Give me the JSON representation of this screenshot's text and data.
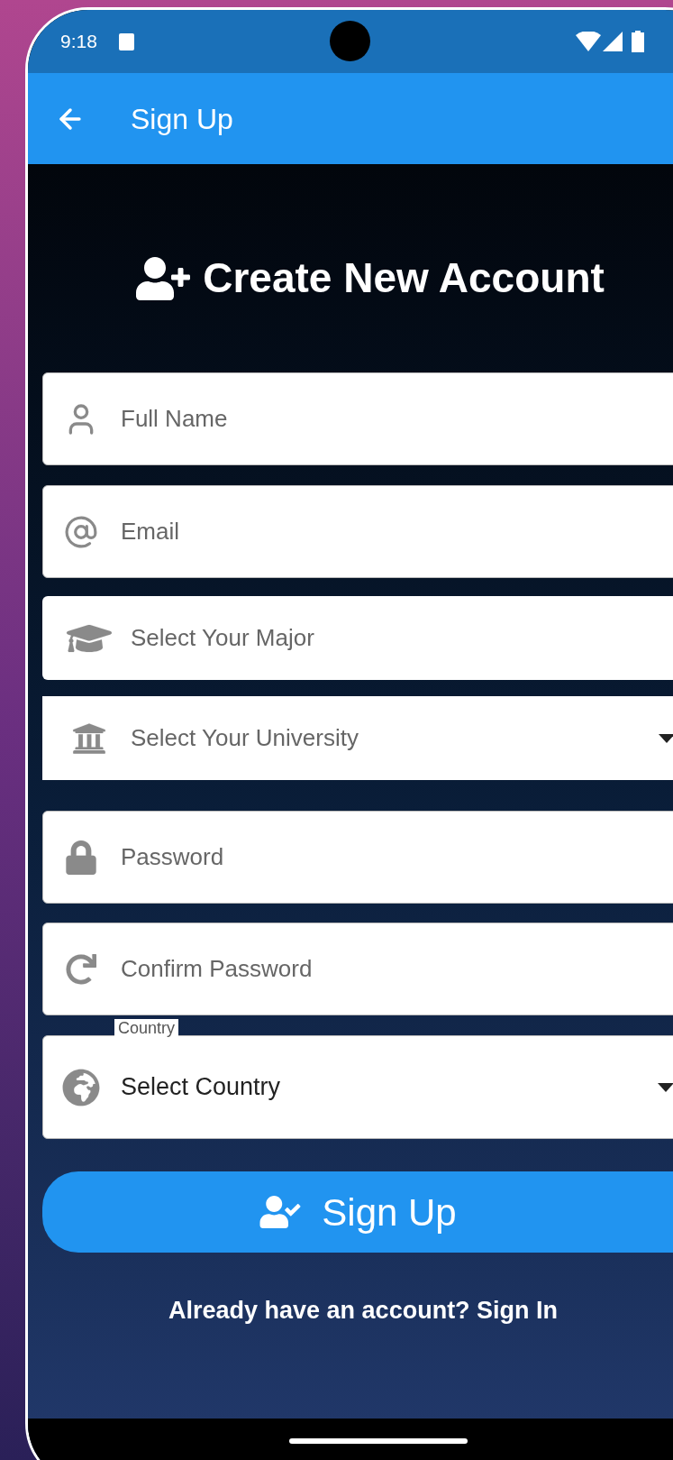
{
  "status_bar": {
    "time": "9:18"
  },
  "app_bar": {
    "title": "Sign Up"
  },
  "heading": "Create New Account",
  "fields": [
    {
      "kind": "input",
      "placeholder": "Full Name"
    },
    {
      "kind": "input",
      "placeholder": "Email"
    },
    {
      "kind": "select",
      "placeholder": "Select Your Major",
      "arrow": false
    },
    {
      "kind": "select",
      "placeholder": "Select Your University",
      "arrow": true
    },
    {
      "kind": "input",
      "placeholder": "Password"
    },
    {
      "kind": "input",
      "placeholder": "Confirm Password"
    },
    {
      "kind": "labeled",
      "label": "Country",
      "value": "Select Country",
      "arrow": true
    }
  ],
  "submit": "Sign Up",
  "sign_in_link": "Already have an account? Sign In"
}
